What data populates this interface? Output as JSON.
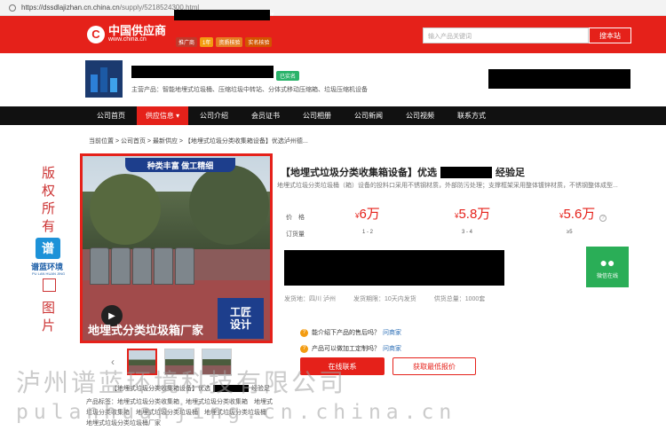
{
  "browser": {
    "url_host": "https://dssdlajizhan.cn.china.cn",
    "url_path": "/supply/5218524300.html"
  },
  "header": {
    "logo_name": "中国供应商",
    "logo_site": "www.china.cn",
    "badges": [
      {
        "label": "推广商",
        "color": "#c0392b"
      },
      {
        "label": "1年",
        "color": "#f39c12"
      },
      {
        "label": "资质核验",
        "color": "#e67e22"
      },
      {
        "label": "实名核验",
        "color": "#d35400"
      }
    ],
    "search_placeholder": "输入产品关键词",
    "search_button": "搜本站"
  },
  "company": {
    "verified_label": "已实名",
    "main_products": "主营产品：智能地埋式垃圾桶、压缩垃圾中转站、分体式移动压缩箱、垃圾压缩机设备"
  },
  "nav": {
    "items": [
      "公司首页",
      "供应信息 ▾",
      "公司介绍",
      "会员证书",
      "公司相册",
      "公司新闻",
      "公司视频",
      "联系方式"
    ],
    "active_index": 1
  },
  "breadcrumb": "当前位置 > 公司首页 > 最新供应 > 【地埋式垃圾分类收集箱设备】优选泸州德...",
  "gallery": {
    "banner_top": "种类丰富 做工精细",
    "caption": "地埋式分类垃圾箱厂家",
    "badge_line1": "工匠",
    "badge_line2": "设计",
    "prev_arrow": "‹",
    "next_arrow": "›"
  },
  "side_mark": {
    "chars_top": [
      "版",
      "权",
      "所",
      "有"
    ],
    "logo_char": "谱",
    "brand": "谱蓝环境",
    "brand_en": "PU LAN HUAN JING",
    "chars_bottom": [
      "图",
      "片"
    ]
  },
  "product": {
    "title_prefix": "【地埋式垃圾分类收集箱设备】优选",
    "title_suffix": "经验足",
    "description": "地埋式垃圾分类垃圾桶（箱）设备的投料口采用不锈钢材质，外部防污处理；支撑框架采用整体镀锌材质，不锈钢整体成型...",
    "price_label": "价　格",
    "qty_label": "订货量",
    "prices": [
      {
        "currency": "¥",
        "value": "6万",
        "qty": "1 - 2"
      },
      {
        "currency": "¥",
        "value": "5.8万",
        "qty": "3 - 4"
      },
      {
        "currency": "¥",
        "value": "5.6万",
        "qty": "≥5"
      }
    ],
    "help_icon": "?",
    "wechat_label": "微信在线",
    "shipping": [
      "发货地：四川 泸州",
      "发货期限：10天内发货",
      "供货总量：1000套"
    ],
    "faqs": [
      {
        "q": "能介绍下产品的售后吗？",
        "ask": "问商家"
      },
      {
        "q": "产品可以做加工定制吗？",
        "ask": "问商家"
      }
    ],
    "contact_button": "在线联系",
    "quote_button": "获取最低报价"
  },
  "below": {
    "caption_prefix": "【地埋式垃圾分类收集箱设备】优选",
    "caption_suffix": "经验足",
    "tags": "产品标签：地埋式垃圾分类收集箱　地埋式垃圾分类收集箱　地埋式垃圾分类收集箱　地埋式垃圾分类垃圾桶　地埋式垃圾分类垃圾桶　地埋式垃圾分类垃圾桶厂家"
  },
  "watermark": {
    "line1": "泸州谱蓝环境科技有限公司",
    "line2": "pulanhuanjing.cn.china.cn"
  }
}
